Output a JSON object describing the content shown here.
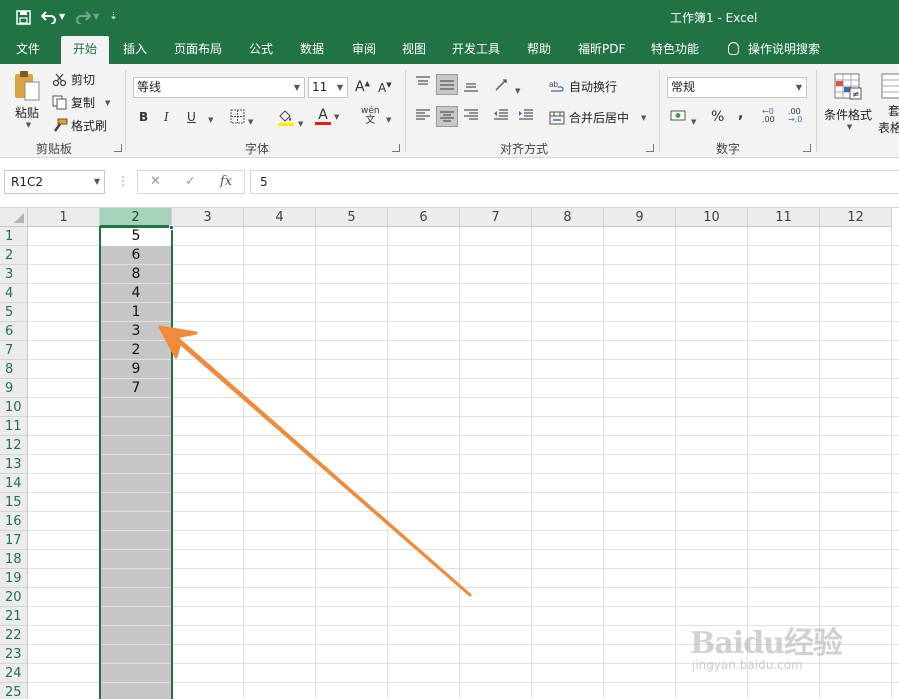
{
  "window": {
    "title": "工作簿1  -  Excel"
  },
  "tabs": [
    {
      "label": "文件"
    },
    {
      "label": "开始"
    },
    {
      "label": "插入"
    },
    {
      "label": "页面布局"
    },
    {
      "label": "公式"
    },
    {
      "label": "数据"
    },
    {
      "label": "审阅"
    },
    {
      "label": "视图"
    },
    {
      "label": "开发工具"
    },
    {
      "label": "帮助"
    },
    {
      "label": "福昕PDF"
    },
    {
      "label": "特色功能"
    },
    {
      "label": "操作说明搜索"
    }
  ],
  "ribbon": {
    "clipboard": {
      "paste": "粘贴",
      "cut": "剪切",
      "copy": "复制",
      "format_painter": "格式刷",
      "label": "剪贴板"
    },
    "font": {
      "name": "等线",
      "size": "11",
      "grow": "A",
      "shrink": "A",
      "bold": "B",
      "italic": "I",
      "underline": "U",
      "pinyin_top": "wén",
      "pinyin_bottom": "文",
      "font_color_glyph": "A",
      "label": "字体"
    },
    "align": {
      "wrap": "自动换行",
      "merge": "合并后居中",
      "label": "对齐方式"
    },
    "number": {
      "format": "常规",
      "percent": "%",
      "comma": ",",
      "label": "数字",
      "inc_top": "←0",
      "inc_bottom": ".00",
      "dec_top": ".00",
      "dec_bottom": "→.0"
    },
    "styles": {
      "conditional": "条件格式",
      "table_line1": "套",
      "table_line2": "表格"
    }
  },
  "formula_bar": {
    "name_box": "R1C2",
    "cancel": "✕",
    "enter": "✓",
    "fx": "fx",
    "value": "5"
  },
  "grid": {
    "columns": [
      "1",
      "2",
      "3",
      "4",
      "5",
      "6",
      "7",
      "8",
      "9",
      "10",
      "11",
      "12"
    ],
    "rows": [
      "1",
      "2",
      "3",
      "4",
      "5",
      "6",
      "7",
      "8",
      "9",
      "10",
      "11",
      "12",
      "13",
      "14",
      "15",
      "16",
      "17",
      "18",
      "19",
      "20",
      "21",
      "22",
      "23",
      "24",
      "25"
    ],
    "selected_column": "2",
    "active_cell": "R1C2",
    "column2_values": [
      "5",
      "6",
      "8",
      "4",
      "1",
      "3",
      "2",
      "9",
      "7"
    ]
  },
  "colors": {
    "accent": "#217346",
    "arrow": "#f08a3c",
    "selection": "#c6c6c6"
  },
  "watermark": {
    "logo": "Baidu经验",
    "url": "jingyan.baidu.com"
  }
}
